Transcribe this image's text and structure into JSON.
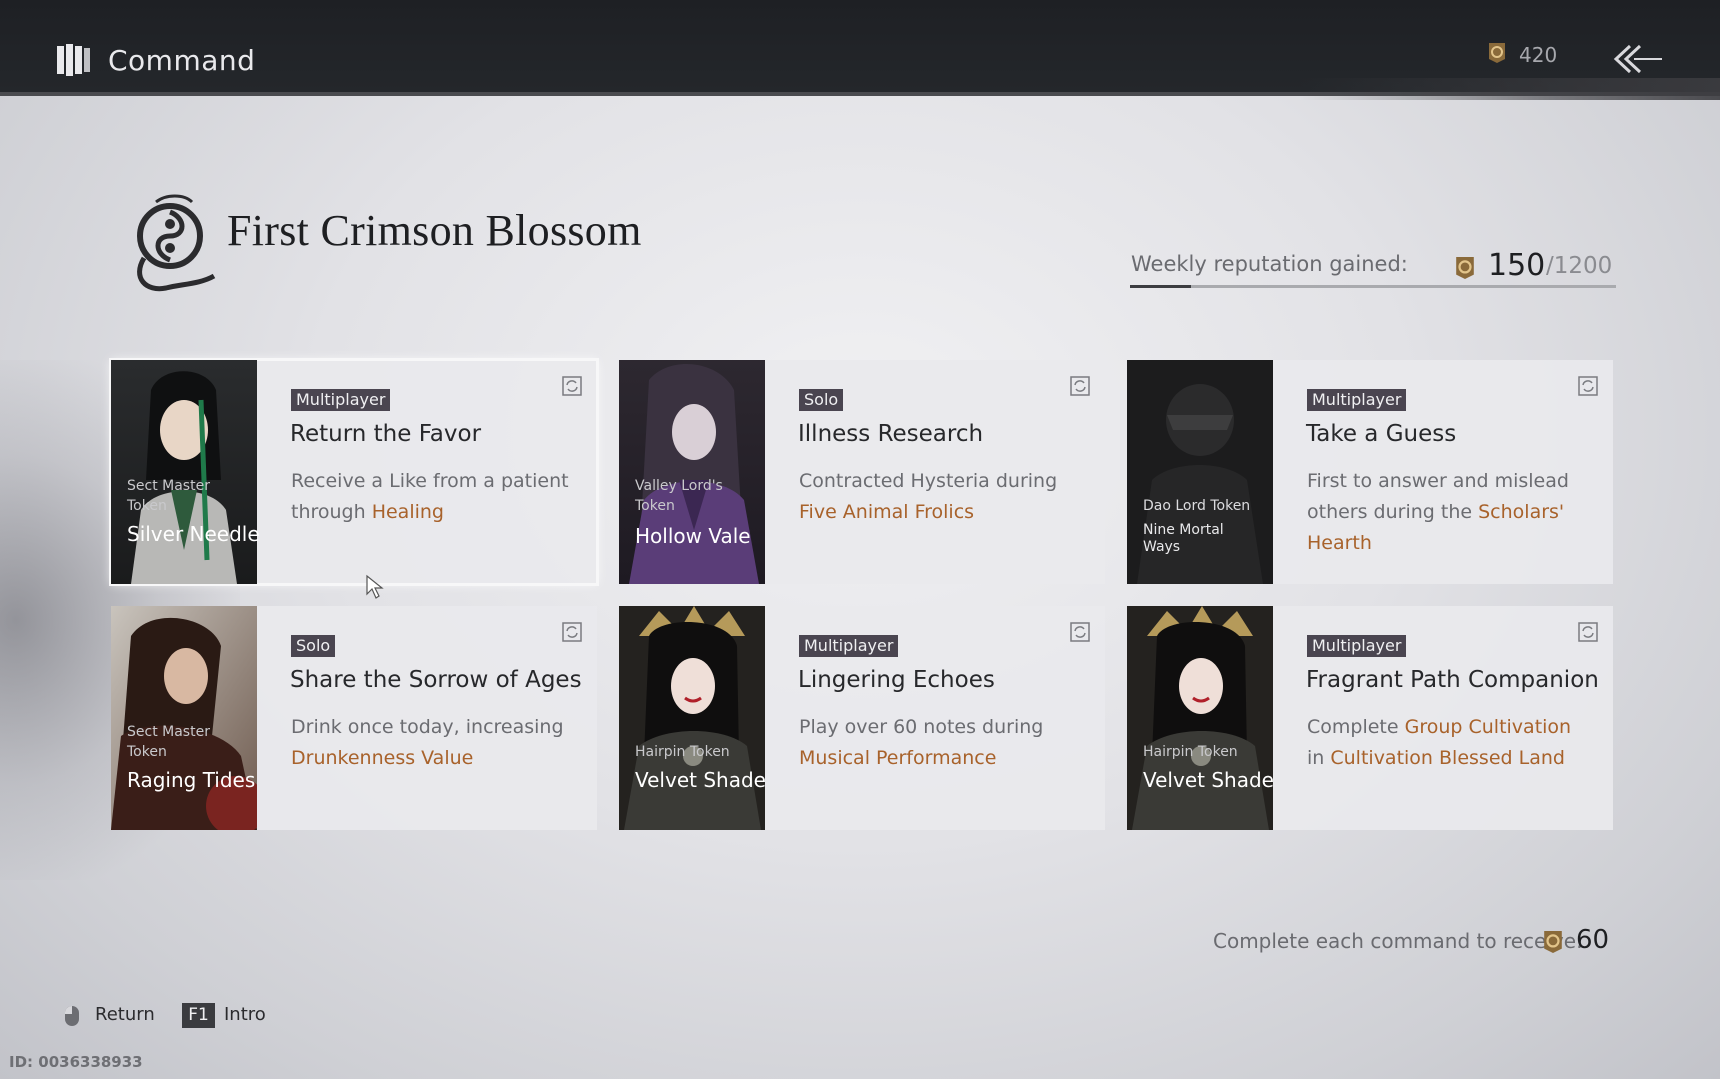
{
  "header": {
    "title": "Command",
    "currency_value": "420",
    "currency_icon": "reputation-seal-icon",
    "back_icon": "back-arrow-icon"
  },
  "faction": {
    "title": "First Crimson Blossom",
    "emblem_icon": "crimson-blossom-emblem-icon"
  },
  "weekly": {
    "label": "Weekly reputation gained:",
    "current": "150",
    "max": "/1200",
    "progress_fraction": 0.125
  },
  "cards": [
    {
      "token_type": "Sect Master Token",
      "token_name": "Silver Needle",
      "token_sub": "",
      "tag": "Multiplayer",
      "title": "Return the Favor",
      "desc_parts": [
        {
          "text": "Receive a Like from a patient through "
        },
        {
          "text": "Healing",
          "highlight": true
        }
      ]
    },
    {
      "token_type": "Valley Lord's Token",
      "token_name": "Hollow Vale",
      "token_sub": "",
      "tag": "Solo",
      "title": "Illness Research",
      "desc_parts": [
        {
          "text": "Contracted Hysteria during "
        },
        {
          "text": "Five Animal Frolics",
          "highlight": true
        }
      ]
    },
    {
      "token_type": "Dao Lord Token",
      "token_name": "",
      "token_sub": "Nine Mortal Ways",
      "tag": "Multiplayer",
      "title": "Take a Guess",
      "desc_parts": [
        {
          "text": "First to answer and mislead others during the "
        },
        {
          "text": "Scholars' Hearth",
          "highlight": true
        }
      ]
    },
    {
      "token_type": "Sect Master Token",
      "token_name": "Raging Tides",
      "token_sub": "",
      "tag": "Solo",
      "title": "Share the Sorrow of Ages",
      "desc_parts": [
        {
          "text": "Drink once today, increasing "
        },
        {
          "text": "Drunkenness Value",
          "highlight": true
        }
      ]
    },
    {
      "token_type": "Hairpin Token",
      "token_name": "Velvet Shade",
      "token_sub": "",
      "tag": "Multiplayer",
      "title": "Lingering Echoes",
      "desc_parts": [
        {
          "text": "Play over 60 notes during "
        },
        {
          "text": "Musical Performance",
          "highlight": true
        }
      ]
    },
    {
      "token_type": "Hairpin Token",
      "token_name": "Velvet Shade",
      "token_sub": "",
      "tag": "Multiplayer",
      "title": "Fragrant Path Companion",
      "desc_parts": [
        {
          "text": "Complete "
        },
        {
          "text": "Group Cultivation",
          "highlight": true
        },
        {
          "text": " in "
        },
        {
          "text": "Cultivation Blessed Land",
          "highlight": true
        }
      ]
    }
  ],
  "reward": {
    "label": "Complete each command to receive:",
    "value": "60"
  },
  "footer": {
    "return_label": "Return",
    "f1_key": "F1",
    "intro_label": "Intro",
    "id_text": "ID: 0036338933"
  },
  "colors": {
    "highlight": "#a8622b",
    "tag_bg": "#4a4550",
    "topbar": "#1e2024"
  }
}
